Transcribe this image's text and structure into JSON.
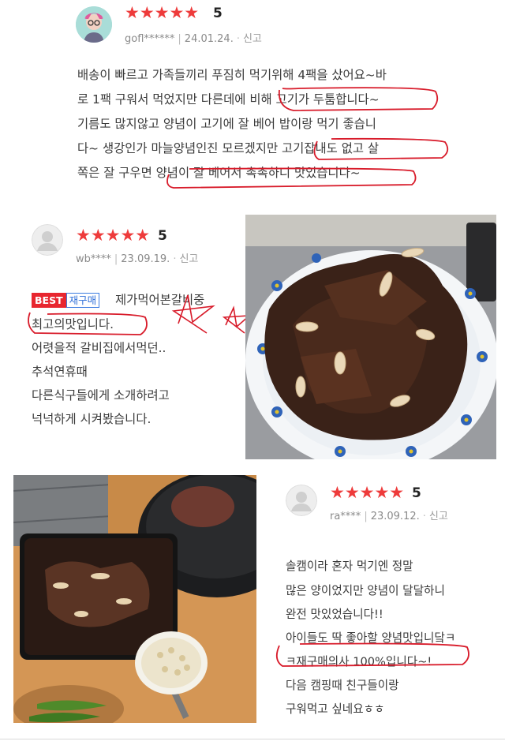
{
  "reviews": [
    {
      "rating_stars": "★★★★★",
      "score": "5",
      "user": "gofl******",
      "date": "24.01.24.",
      "report": "신고",
      "lines": [
        "배송이 빠르고 가족들끼리 푸짐히 먹기위해 4팩을 샀어요~바",
        "로 1팩 구워서 먹었지만 다른데에 비해 고기가 두툼합니다~",
        "기름도 많지않고 양념이 고기에 잘 베어  밥이랑 먹기 좋습니",
        "다~ 생강인가 마늘양념인진 모르겠지만 고기잡내도 없고 살",
        "쪽은 잘 구우면 양념이 잘 베어서 촉촉하니 맛있습니다~"
      ]
    },
    {
      "rating_stars": "★★★★★",
      "score": "5",
      "user": "wb****",
      "date": "23.09.19.",
      "report": "신고",
      "badge_best": "BEST",
      "badge_repurchase": "재구매",
      "lines": [
        "제가먹어본갈비중",
        "최고의맛입니다.",
        "어렷을적 갈비집에서먹던..",
        "추석연휴때",
        "다른식구들에게 소개하려고",
        "넉넉하게 시켜봤습니다."
      ]
    },
    {
      "rating_stars": "★★★★★",
      "score": "5",
      "user": "ra****",
      "date": "23.09.12.",
      "report": "신고",
      "lines": [
        "솔캠이라 혼자 먹기엔 정말",
        "많은 양이었지만 양념이 달달하니",
        "완전 맛있었습니다!!",
        "아이들도 딱 좋아할 양념맛입니닼ㅋ",
        "ㅋ재구매의사 100%입니다~!",
        "다음 캠핑때 친구들이랑",
        "구워먹고 싶네요ㅎㅎ"
      ]
    }
  ],
  "colors": {
    "star": "#ee3b3b",
    "annotation_ink": "#d81b2a",
    "best_badge": "#e8262f",
    "repurchase_badge": "#2f6fd8"
  },
  "icons": [
    "user-avatar-icon",
    "default-avatar-icon",
    "star-icon"
  ]
}
